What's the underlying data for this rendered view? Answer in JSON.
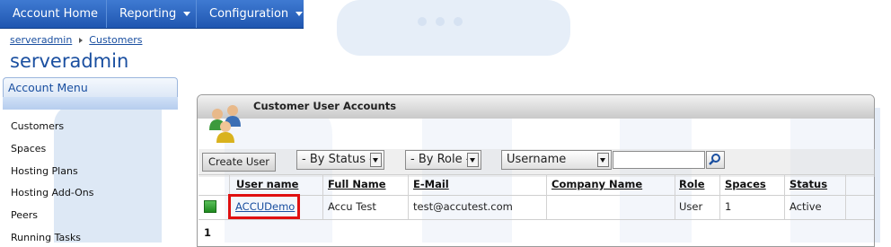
{
  "nav": {
    "account_home": "Account Home",
    "reporting": "Reporting",
    "configuration": "Configuration"
  },
  "breadcrumb": {
    "root": "serveradmin",
    "current": "Customers"
  },
  "page_title": "serveradmin",
  "sidebar": {
    "title": "Account Menu",
    "items": [
      "Customers",
      "Spaces",
      "Hosting Plans",
      "Hosting Add-Ons",
      "Peers",
      "Running Tasks"
    ]
  },
  "panel": {
    "title": "Customer User Accounts"
  },
  "toolbar": {
    "create_user": "Create User",
    "status_filter": "- By Status -",
    "role_filter": "- By Role -",
    "search_field": "Username",
    "search_value": ""
  },
  "table": {
    "columns": [
      "User name",
      "Full Name",
      "E-Mail",
      "Company Name",
      "Role",
      "Spaces",
      "Status"
    ],
    "rows": [
      {
        "username": "ACCUDemo",
        "full_name": "Accu Test",
        "email": "test@accutest.com",
        "company": "",
        "role": "User",
        "spaces": "1",
        "status": "Active"
      }
    ]
  },
  "pager": {
    "page": "1"
  },
  "colors": {
    "nav_bg": "#2a63bf",
    "link": "#1a4fa0",
    "highlight": "#e01010",
    "status_active": "#2a9a2a"
  },
  "icons": [
    "caret-down-icon",
    "breadcrumb-separator-icon",
    "users-group-icon",
    "search-icon",
    "active-user-icon"
  ]
}
